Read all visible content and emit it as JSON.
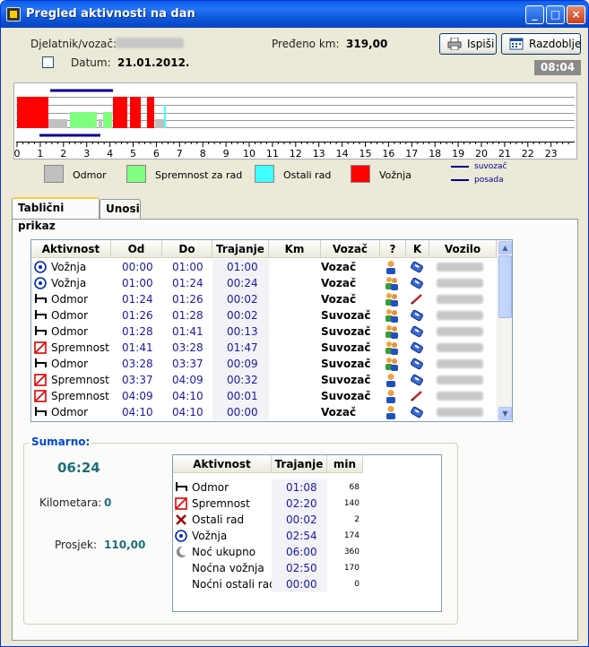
{
  "window": {
    "title": "Pregled aktivnosti na dan",
    "controls": [
      "_",
      "□",
      "×"
    ]
  },
  "header": {
    "worker_label": "Djelatnik/vozač:",
    "km_label": "Pređeno km:",
    "km_value": "319,00",
    "date_label": "Datum:",
    "date_value": "21.01.2012.",
    "print_label": "Ispiši",
    "period_label": "Razdoblje",
    "time": "08:04"
  },
  "timeline": {
    "hours": [
      "0",
      "1",
      "2",
      "3",
      "4",
      "5",
      "6",
      "7",
      "8",
      "9",
      "10",
      "11",
      "12",
      "13",
      "14",
      "15",
      "16",
      "17",
      "18",
      "19",
      "20",
      "21",
      "22",
      "23"
    ]
  },
  "legend": {
    "items": [
      {
        "label": "Odmor",
        "color": "#c0c0c0"
      },
      {
        "label": "Spremnost za rad",
        "color": "#80ff80"
      },
      {
        "label": "Ostali rad",
        "color": "#40ffff"
      },
      {
        "label": "Vožnja",
        "color": "#ff0000"
      }
    ],
    "line_labels": [
      "suvozač",
      "posada"
    ],
    "line_color": "#000090"
  },
  "tabs": [
    {
      "label": "Tablični prikaz",
      "active": true
    },
    {
      "label": "Unosi",
      "active": false
    }
  ],
  "table": {
    "columns": [
      "Aktivnost",
      "Od",
      "Do",
      "Trajanje",
      "Km",
      "Vozač",
      "?",
      "K",
      "Vozilo"
    ],
    "rows": [
      {
        "icon": "drive",
        "activity": "Vožnja",
        "from": "00:00",
        "to": "01:00",
        "duration": "01:00",
        "km": "",
        "driver": "Vozač",
        "q": "user",
        "k": "card"
      },
      {
        "icon": "drive",
        "activity": "Vožnja",
        "from": "01:00",
        "to": "01:24",
        "duration": "00:24",
        "km": "",
        "driver": "Vozač",
        "q": "users",
        "k": "card"
      },
      {
        "icon": "rest",
        "activity": "Odmor",
        "from": "01:24",
        "to": "01:26",
        "duration": "00:02",
        "km": "",
        "driver": "Vozač",
        "q": "users",
        "k": "pen"
      },
      {
        "icon": "rest",
        "activity": "Odmor",
        "from": "01:26",
        "to": "01:28",
        "duration": "00:02",
        "km": "",
        "driver": "Suvozač",
        "q": "users",
        "k": "card"
      },
      {
        "icon": "rest",
        "activity": "Odmor",
        "from": "01:28",
        "to": "01:41",
        "duration": "00:13",
        "km": "",
        "driver": "Suvozač",
        "q": "users",
        "k": "card"
      },
      {
        "icon": "ready",
        "activity": "Spremnost",
        "from": "01:41",
        "to": "03:28",
        "duration": "01:47",
        "km": "",
        "driver": "Suvozač",
        "q": "users",
        "k": "card"
      },
      {
        "icon": "rest",
        "activity": "Odmor",
        "from": "03:28",
        "to": "03:37",
        "duration": "00:09",
        "km": "",
        "driver": "Suvozač",
        "q": "users",
        "k": "card"
      },
      {
        "icon": "ready",
        "activity": "Spremnost",
        "from": "03:37",
        "to": "04:09",
        "duration": "00:32",
        "km": "",
        "driver": "Suvozač",
        "q": "user",
        "k": "card"
      },
      {
        "icon": "ready",
        "activity": "Spremnost",
        "from": "04:09",
        "to": "04:10",
        "duration": "00:01",
        "km": "",
        "driver": "Suvozač",
        "q": "user",
        "k": "pen"
      },
      {
        "icon": "rest",
        "activity": "Odmor",
        "from": "04:10",
        "to": "04:10",
        "duration": "00:00",
        "km": "",
        "driver": "Vozač",
        "q": "user",
        "k": "card"
      }
    ]
  },
  "summary": {
    "title": "Sumarno:",
    "total_time": "06:24",
    "km_label": "Kilometara:",
    "km_value": "0",
    "avg_label": "Prosjek:",
    "avg_value": "110,00",
    "columns": [
      "Aktivnost",
      "Trajanje",
      "min"
    ],
    "rows": [
      {
        "icon": "rest",
        "activity": "Odmor",
        "duration": "01:08",
        "min": "68"
      },
      {
        "icon": "ready",
        "activity": "Spremnost",
        "duration": "02:20",
        "min": "140"
      },
      {
        "icon": "work",
        "activity": "Ostali rad",
        "duration": "00:02",
        "min": "2"
      },
      {
        "icon": "drive",
        "activity": "Vožnja",
        "duration": "02:54",
        "min": "174"
      },
      {
        "icon": "night",
        "activity": "Noć ukupno",
        "duration": "06:00",
        "min": "360"
      },
      {
        "icon": "",
        "activity": "Noćna vožnja",
        "duration": "02:50",
        "min": "170"
      },
      {
        "icon": "",
        "activity": "Noćni ostali rad",
        "duration": "00:00",
        "min": "0"
      }
    ]
  }
}
